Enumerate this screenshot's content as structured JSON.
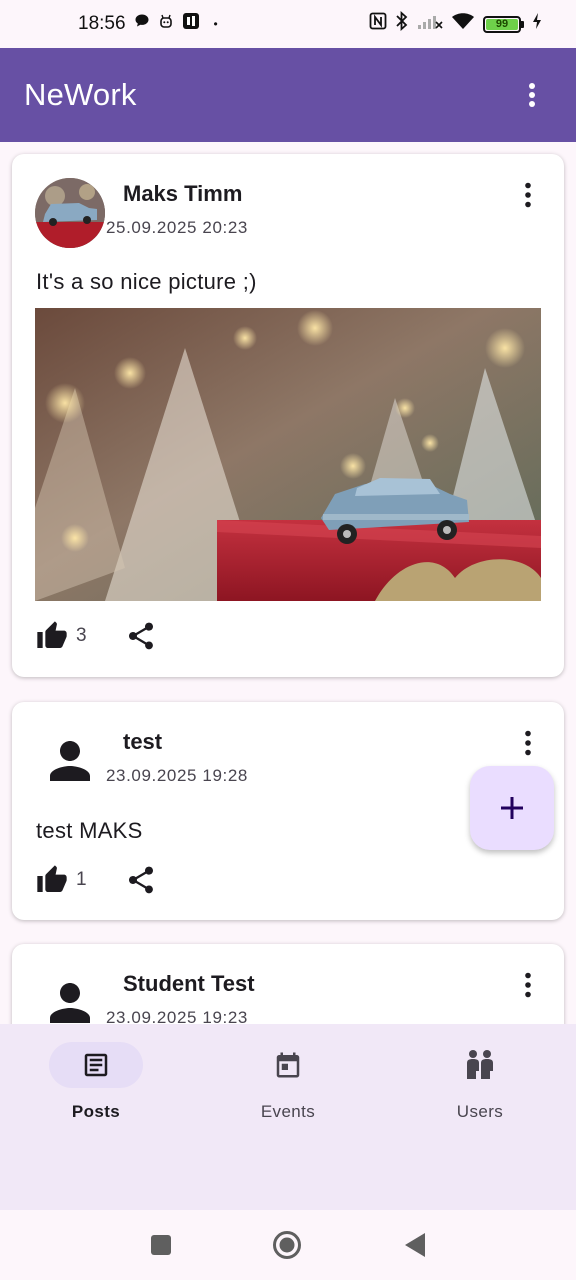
{
  "status_bar": {
    "time": "18:56",
    "battery_level": "99",
    "left_icons": [
      "chat-bubble-icon",
      "notification-bot-icon",
      "office-app-icon",
      "dot-icon"
    ],
    "right_icons": [
      "nfc-icon",
      "bluetooth-icon",
      "no-signal-icon",
      "wifi-icon",
      "battery-icon",
      "charging-icon"
    ]
  },
  "app_bar": {
    "title": "NeWork",
    "menu_icon": "more-vert-icon",
    "background_color": "#6750a4"
  },
  "posts": [
    {
      "author": "Maks Timm",
      "date": "25.09.2025 20:23",
      "avatar": "photo",
      "text": "It's a so nice picture ;)",
      "has_image": true,
      "image_description_icon": "toy-car-photo",
      "likes": "3"
    },
    {
      "author": "test",
      "date": "23.09.2025 19:28",
      "avatar": "person-icon",
      "text": "test MAKS",
      "has_image": false,
      "likes": "1"
    },
    {
      "author": "Student Test",
      "date": "23.09.2025 19:23",
      "avatar": "person-icon"
    }
  ],
  "fab": {
    "icon": "plus-icon"
  },
  "bottom_nav": {
    "items": [
      {
        "label": "Posts",
        "icon": "article-icon",
        "active": true
      },
      {
        "label": "Events",
        "icon": "calendar-icon",
        "active": false
      },
      {
        "label": "Users",
        "icon": "people-icon",
        "active": false
      }
    ]
  },
  "system_nav": [
    "recents-button",
    "home-button",
    "back-button"
  ],
  "colors": {
    "primary": "#6750a4",
    "fab": "#eaddff",
    "nav_background": "#f1e8f7",
    "nav_indicator": "#e6ddf6"
  }
}
